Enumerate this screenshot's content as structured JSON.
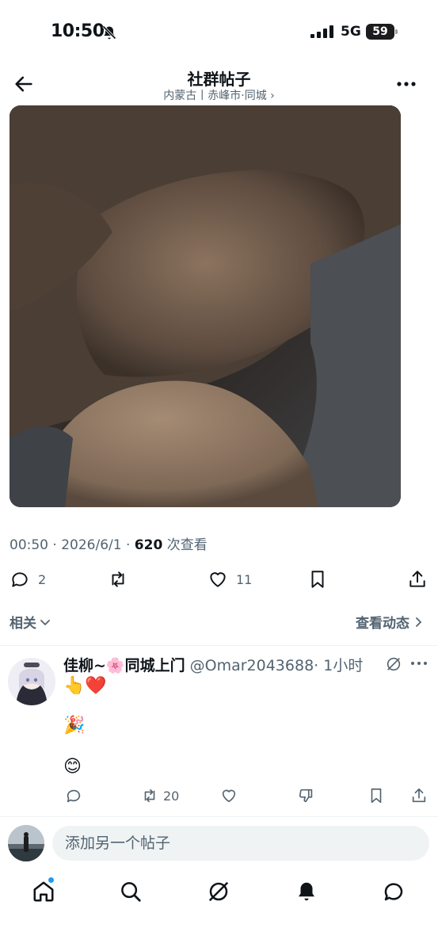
{
  "status_bar": {
    "time": "10:50",
    "network": "5G",
    "battery": "59"
  },
  "nav": {
    "title": "社群帖子",
    "subtitle": "内蒙古丨赤峰市·同城 ›"
  },
  "post": {
    "time": "00:50",
    "date": "2026/6/1",
    "views": "620",
    "views_label": "次查看",
    "replies": "2",
    "reposts": "",
    "likes": "11"
  },
  "related": {
    "label": "相关",
    "activity": "查看动态"
  },
  "reply": {
    "name": "佳柳~🌸同城上门",
    "handle": "@Omar2043688",
    "time": "· 1小时",
    "lines": [
      "👆❤️",
      "🎉",
      "😊"
    ],
    "reposts": "20"
  },
  "compose": {
    "placeholder": "添加另一个帖子"
  },
  "colors": {
    "accent": "#1d9bf0",
    "muted": "#536471",
    "text": "#0f1419"
  }
}
